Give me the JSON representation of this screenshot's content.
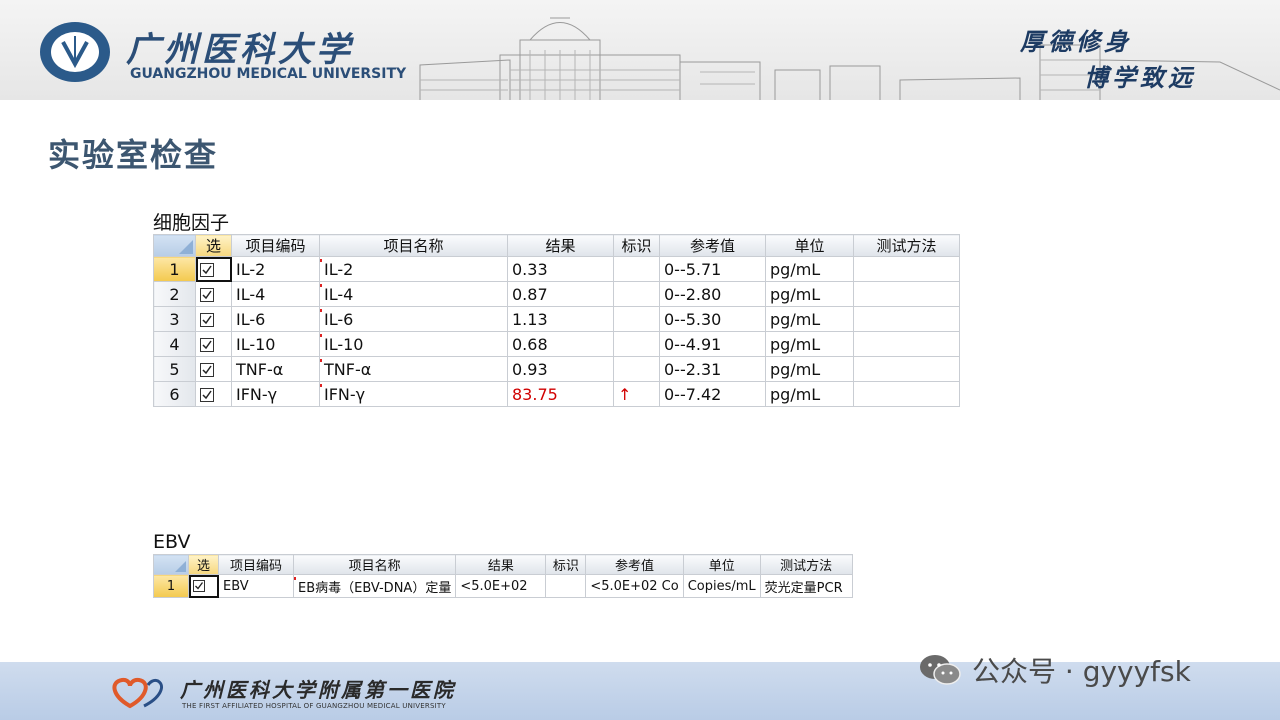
{
  "header": {
    "university_cn": "广州医科大学",
    "university_en": "GUANGZHOU MEDICAL UNIVERSITY",
    "motto_line1": "厚德修身",
    "motto_line2": "博学致远"
  },
  "slide_title": "实验室检查",
  "cytokine": {
    "label": "细胞因子",
    "columns": [
      "选",
      "项目编码",
      "项目名称",
      "结果",
      "标识",
      "参考值",
      "单位",
      "测试方法"
    ],
    "rows": [
      {
        "num": "1",
        "code": "IL-2",
        "name": "IL-2",
        "result": "0.33",
        "flag": "",
        "ref": "0--5.71",
        "unit": "pg/mL",
        "method": ""
      },
      {
        "num": "2",
        "code": "IL-4",
        "name": "IL-4",
        "result": "0.87",
        "flag": "",
        "ref": "0--2.80",
        "unit": "pg/mL",
        "method": ""
      },
      {
        "num": "3",
        "code": "IL-6",
        "name": "IL-6",
        "result": "1.13",
        "flag": "",
        "ref": "0--5.30",
        "unit": "pg/mL",
        "method": ""
      },
      {
        "num": "4",
        "code": "IL-10",
        "name": "IL-10",
        "result": "0.68",
        "flag": "",
        "ref": "0--4.91",
        "unit": "pg/mL",
        "method": ""
      },
      {
        "num": "5",
        "code": "TNF-α",
        "name": "TNF-α",
        "result": "0.93",
        "flag": "",
        "ref": "0--2.31",
        "unit": "pg/mL",
        "method": ""
      },
      {
        "num": "6",
        "code": "IFN-γ",
        "name": "IFN-γ",
        "result": "83.75",
        "flag": "↑",
        "ref": "0--7.42",
        "unit": "pg/mL",
        "method": ""
      }
    ]
  },
  "ebv": {
    "label": "EBV",
    "columns": [
      "选",
      "项目编码",
      "项目名称",
      "结果",
      "标识",
      "参考值",
      "单位",
      "测试方法"
    ],
    "rows": [
      {
        "num": "1",
        "code": "EBV",
        "name": "EB病毒（EBV-DNA）定量",
        "result": "<5.0E+02",
        "flag": "",
        "ref": "<5.0E+02 Co",
        "unit": "Copies/mL",
        "method": "荧光定量PCR"
      }
    ]
  },
  "footer": {
    "hospital_cn": "广州医科大学附属第一医院",
    "hospital_en": "THE FIRST AFFILIATED HOSPITAL OF GUANGZHOU MEDICAL UNIVERSITY",
    "watermark": "公众号 · gyyyfsk"
  },
  "colors": {
    "title": "#3c5670",
    "brand_blue": "#2b4e78",
    "abnormal_red": "#d10000",
    "footer_bg": "#c4d4ea"
  }
}
